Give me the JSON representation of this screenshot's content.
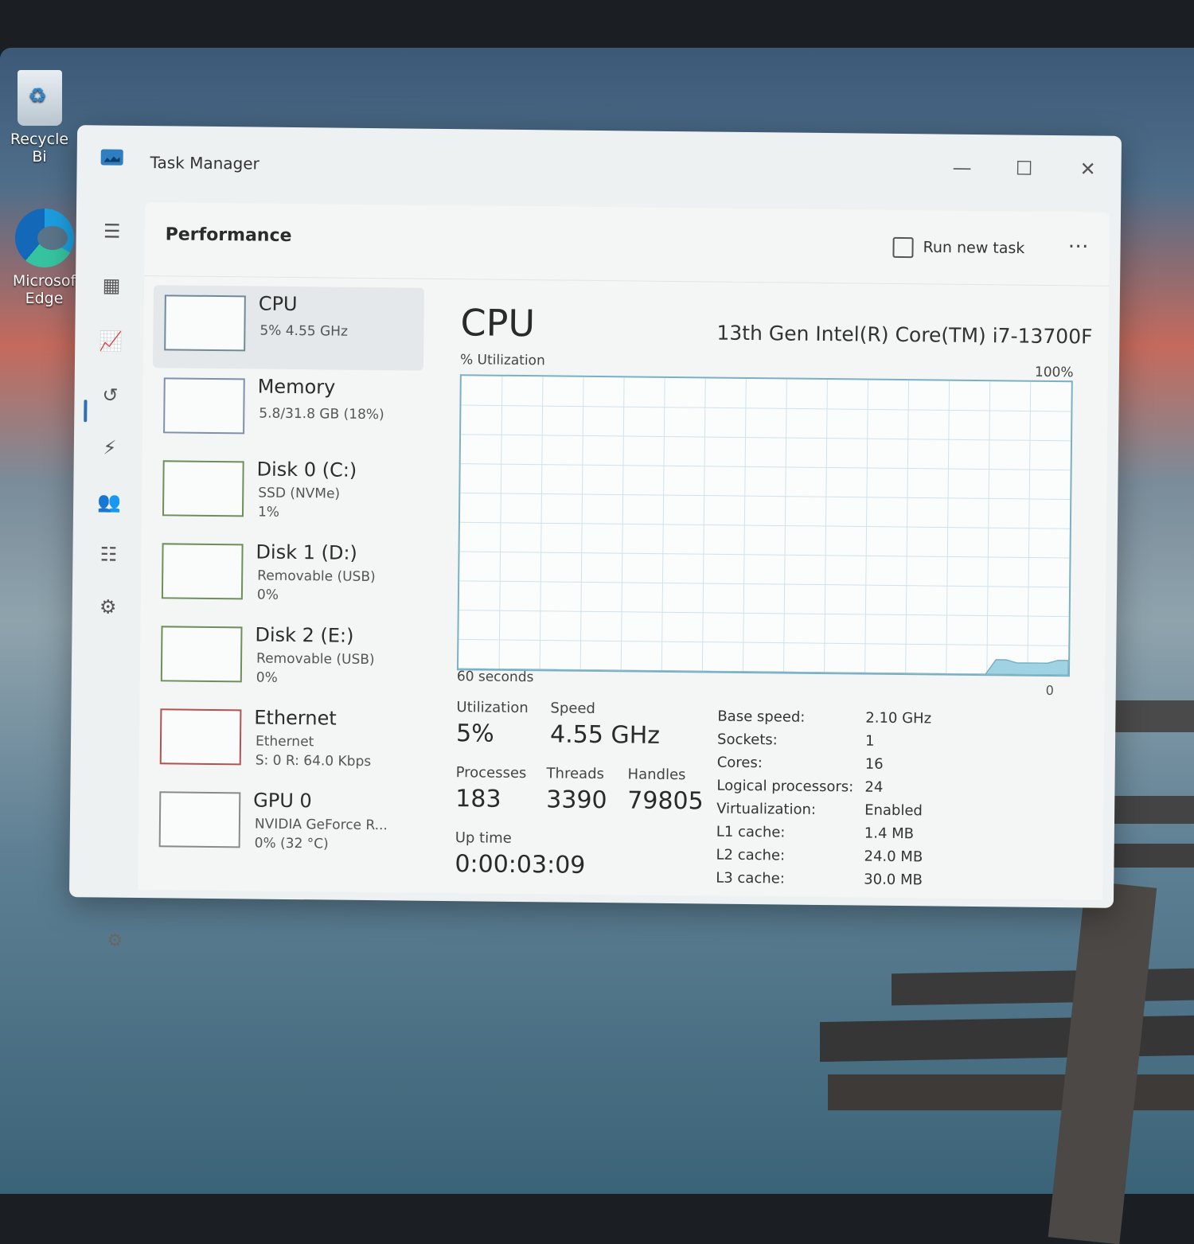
{
  "desktop": {
    "icons": [
      {
        "label": "Recycle Bi"
      },
      {
        "label_line1": "Microsof",
        "label_line2": "Edge"
      }
    ]
  },
  "window": {
    "title": "Task Manager",
    "controls": {
      "minimize": "—",
      "maximize": "☐",
      "close": "✕"
    }
  },
  "header": {
    "title": "Performance",
    "run_new_task": "Run new task",
    "more": "⋯"
  },
  "devices": [
    {
      "name": "CPU",
      "sub1": "5%  4.55 GHz",
      "sub2": ""
    },
    {
      "name": "Memory",
      "sub1": "5.8/31.8 GB (18%)",
      "sub2": ""
    },
    {
      "name": "Disk 0 (C:)",
      "sub1": "SSD (NVMe)",
      "sub2": "1%"
    },
    {
      "name": "Disk 1 (D:)",
      "sub1": "Removable (USB)",
      "sub2": "0%"
    },
    {
      "name": "Disk 2 (E:)",
      "sub1": "Removable (USB)",
      "sub2": "0%"
    },
    {
      "name": "Ethernet",
      "sub1": "Ethernet",
      "sub2": "S: 0  R: 64.0 Kbps"
    },
    {
      "name": "GPU 0",
      "sub1": "NVIDIA GeForce R...",
      "sub2": "0%  (32 °C)"
    }
  ],
  "cpu": {
    "title": "CPU",
    "model": "13th Gen Intel(R) Core(TM) i7-13700F",
    "util_label": "% Utilization",
    "max_label": "100%",
    "time_label": "60 seconds",
    "min_label": "0",
    "stats": {
      "utilization_label": "Utilization",
      "utilization": "5%",
      "speed_label": "Speed",
      "speed": "4.55 GHz",
      "processes_label": "Processes",
      "processes": "183",
      "threads_label": "Threads",
      "threads": "3390",
      "handles_label": "Handles",
      "handles": "79805",
      "uptime_label": "Up time",
      "uptime": "0:00:03:09"
    },
    "specs": [
      {
        "label": "Base speed:",
        "value": "2.10 GHz"
      },
      {
        "label": "Sockets:",
        "value": "1"
      },
      {
        "label": "Cores:",
        "value": "16"
      },
      {
        "label": "Logical processors:",
        "value": "24"
      },
      {
        "label": "Virtualization:",
        "value": "Enabled"
      },
      {
        "label": "L1 cache:",
        "value": "1.4 MB"
      },
      {
        "label": "L2 cache:",
        "value": "24.0 MB"
      },
      {
        "label": "L3 cache:",
        "value": "30.0 MB"
      }
    ],
    "graph_recent_pct": [
      0,
      0,
      0,
      0,
      0,
      0,
      0,
      0,
      0,
      0,
      0,
      0,
      0,
      0,
      0,
      0,
      0,
      0,
      0,
      0,
      0,
      0,
      0,
      0,
      0,
      0,
      0,
      0,
      0,
      0,
      0,
      0,
      0,
      0,
      0,
      0,
      0,
      0,
      0,
      0,
      0,
      0,
      0,
      0,
      0,
      0,
      0,
      0,
      0,
      0,
      0,
      0,
      5,
      5,
      4,
      4,
      4,
      4,
      5,
      5
    ]
  },
  "colors": {
    "accent": "#2a6fb8",
    "cpu_graph": "#7ab0c4",
    "cpu_fill": "#9fd3e3"
  }
}
